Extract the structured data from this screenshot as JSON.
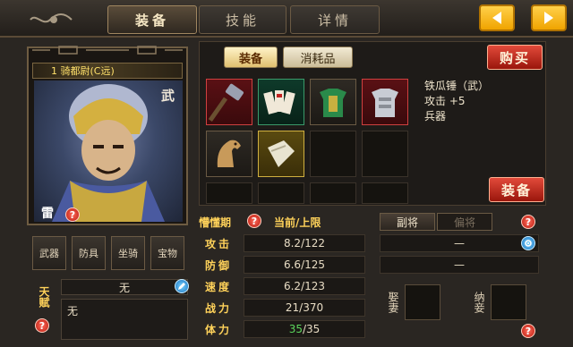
{
  "tabs": {
    "equip": "装备",
    "skills": "技能",
    "details": "详情"
  },
  "general": {
    "name_plate": "1 骑都尉(C远)",
    "type_char": "武",
    "element_char": "雷"
  },
  "equip_slots": [
    "武器",
    "防具",
    "坐骑",
    "宝物"
  ],
  "talent": {
    "label": "天赋",
    "value": "无",
    "desc": "无"
  },
  "inventory": {
    "subtab_equip": "装备",
    "subtab_consumable": "消耗品",
    "buy_button": "购买",
    "equip_button": "装备",
    "items": [
      {
        "name": "hammer-icon",
        "style": "red"
      },
      {
        "name": "scroll-cards-icon",
        "style": "green"
      },
      {
        "name": "green-armor-icon",
        "style": "plain"
      },
      {
        "name": "silver-armor-icon",
        "style": "red"
      },
      {
        "name": "horse-icon",
        "style": "plain"
      },
      {
        "name": "cloth-bundle-icon",
        "style": "gold"
      }
    ],
    "detail": {
      "title": "铁瓜锤（武）",
      "line1": "攻击 +5",
      "line2": "兵器"
    }
  },
  "stats": {
    "header_label": "懵懂期",
    "header_value": "当前/上限",
    "rows": [
      {
        "label": "攻击",
        "value": "8.2/122"
      },
      {
        "label": "防御",
        "value": "6.6/125"
      },
      {
        "label": "速度",
        "value": "6.2/123"
      },
      {
        "label": "战力",
        "value": "21/370"
      },
      {
        "label": "体力",
        "value_current": "35",
        "value_max": "/35"
      }
    ]
  },
  "generals_panel": {
    "tab_vice": "副将",
    "tab_partial": "偏将",
    "slot1": "—",
    "slot2": "—",
    "wife_label": "娶妻",
    "concubine_label": "纳妾"
  },
  "colors": {
    "accent_gold": "#ffd25a",
    "button_red": "#c42a1c",
    "arrow_yellow": "#f7b500",
    "stamina_green": "#5cd65c"
  }
}
